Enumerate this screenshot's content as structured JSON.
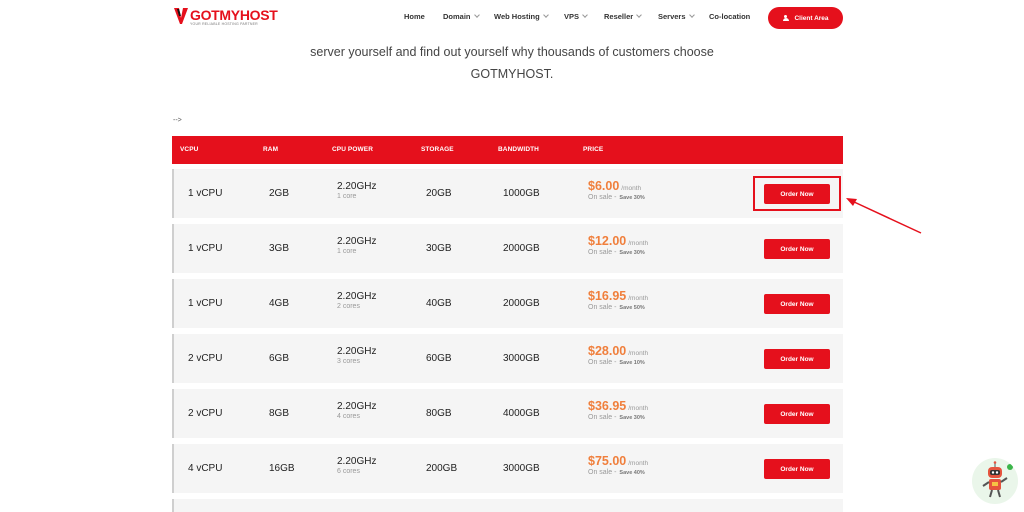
{
  "brand": {
    "name": "GOTMYHOST",
    "tagline": "YOUR RELIABLE HOSTING PARTNER",
    "accent": "#e5101c"
  },
  "nav": {
    "items": [
      {
        "label": "Home",
        "dropdown": false
      },
      {
        "label": "Domain",
        "dropdown": true
      },
      {
        "label": "Web Hosting",
        "dropdown": true
      },
      {
        "label": "VPS",
        "dropdown": true
      },
      {
        "label": "Reseller",
        "dropdown": true
      },
      {
        "label": "Servers",
        "dropdown": true
      },
      {
        "label": "Co-location",
        "dropdown": false
      }
    ],
    "client_area": "Client Area"
  },
  "intro": {
    "line1": "server yourself and find out yourself why thousands of customers choose",
    "line2": "GOTMYHOST."
  },
  "stray_text": "-->",
  "table": {
    "headers": [
      "VCPU",
      "RAM",
      "CPU POWER",
      "STORAGE",
      "BANDWIDTH",
      "PRICE"
    ],
    "rows": [
      {
        "vcpu": "1 vCPU",
        "ram": "2GB",
        "cpu": "2.20GHz",
        "cores": "1 core",
        "storage": "20GB",
        "bandwidth": "1000GB",
        "price": "$6.00",
        "unit": "/month",
        "sale": "On sale -",
        "save": "Save 30%",
        "order": "Order Now"
      },
      {
        "vcpu": "1 vCPU",
        "ram": "3GB",
        "cpu": "2.20GHz",
        "cores": "1 core",
        "storage": "30GB",
        "bandwidth": "2000GB",
        "price": "$12.00",
        "unit": "/month",
        "sale": "On sale -",
        "save": "Save 30%",
        "order": "Order Now"
      },
      {
        "vcpu": "1 vCPU",
        "ram": "4GB",
        "cpu": "2.20GHz",
        "cores": "2 cores",
        "storage": "40GB",
        "bandwidth": "2000GB",
        "price": "$16.95",
        "unit": "/month",
        "sale": "On sale -",
        "save": "Save 50%",
        "order": "Order Now"
      },
      {
        "vcpu": "2 vCPU",
        "ram": "6GB",
        "cpu": "2.20GHz",
        "cores": "3 cores",
        "storage": "60GB",
        "bandwidth": "3000GB",
        "price": "$28.00",
        "unit": "/month",
        "sale": "On sale -",
        "save": "Save 10%",
        "order": "Order Now"
      },
      {
        "vcpu": "2 vCPU",
        "ram": "8GB",
        "cpu": "2.20GHz",
        "cores": "4 cores",
        "storage": "80GB",
        "bandwidth": "4000GB",
        "price": "$36.95",
        "unit": "/month",
        "sale": "On sale -",
        "save": "Save 30%",
        "order": "Order Now"
      },
      {
        "vcpu": "4 vCPU",
        "ram": "16GB",
        "cpu": "2.20GHz",
        "cores": "6 cores",
        "storage": "200GB",
        "bandwidth": "3000GB",
        "price": "$75.00",
        "unit": "/month",
        "sale": "On sale -",
        "save": "Save 40%",
        "order": "Order Now"
      }
    ]
  },
  "icons": {
    "user": "user-icon",
    "caret": "chevron-down-icon",
    "chat_bot": "robot-chat-icon",
    "logo_mark": "logo-mark-icon"
  },
  "colors": {
    "accent": "#e5101c",
    "price": "#f07f3c",
    "row_bg": "#f5f5f5"
  }
}
